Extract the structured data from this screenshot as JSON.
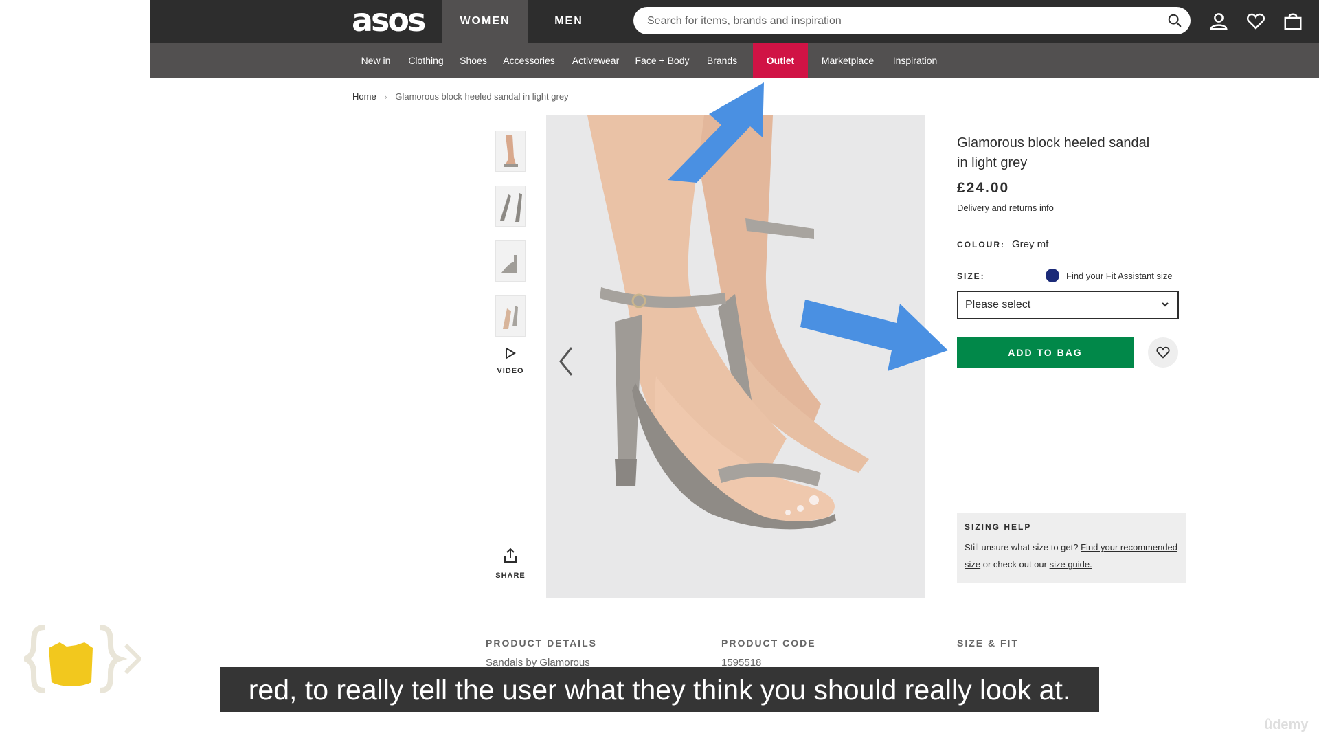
{
  "header": {
    "logo_text": "asos",
    "tabs": [
      {
        "label": "WOMEN",
        "active": true
      },
      {
        "label": "MEN",
        "active": false
      }
    ],
    "search_placeholder": "Search for items, brands and inspiration",
    "icons": [
      "search-icon",
      "account-icon",
      "wishlist-icon",
      "bag-icon"
    ]
  },
  "nav": {
    "items": [
      "New in",
      "Clothing",
      "Shoes",
      "Accessories",
      "Activewear",
      "Face + Body",
      "Brands",
      "Outlet",
      "Marketplace",
      "Inspiration"
    ],
    "highlight_color": "#d01345"
  },
  "breadcrumb": {
    "home": "Home",
    "separator": "›",
    "current": "Glamorous block heeled sandal in light grey"
  },
  "media": {
    "video_label": "VIDEO",
    "share_label": "SHARE"
  },
  "product": {
    "title": "Glamorous block heeled sandal in light grey",
    "price": "£24.00",
    "delivery_link": "Delivery and returns info",
    "colour_label": "COLOUR:",
    "colour_value": "Grey mf",
    "size_label": "SIZE:",
    "fit_assistant_link": "Find your Fit Assistant size",
    "size_select_value": "Please select",
    "add_to_bag": "ADD TO BAG",
    "add_to_bag_color": "#018849"
  },
  "sizing_help": {
    "title": "SIZING HELP",
    "text_prefix": "Still unsure what size to get?",
    "link1": "Find your recommended size",
    "text_middle": "or check out our",
    "link2": "size guide."
  },
  "details": {
    "product_details_head": "PRODUCT DETAILS",
    "product_details_value": "Sandals by Glamorous",
    "product_code_head": "PRODUCT CODE",
    "product_code_value": "1595518",
    "size_fit_head": "SIZE & FIT"
  },
  "annotation": {
    "arrow_color": "#4a90e2"
  },
  "subtitle": "red, to really tell the user what they think you should really look at.",
  "watermark": "ûdemy"
}
